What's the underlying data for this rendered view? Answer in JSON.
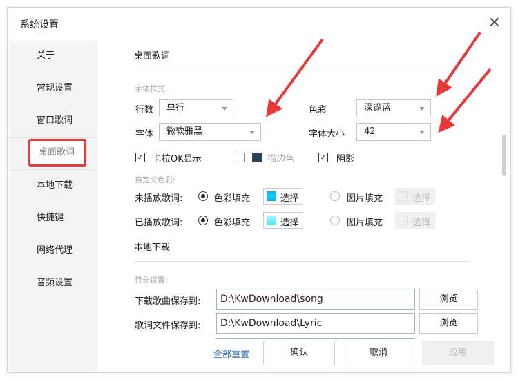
{
  "window": {
    "title": "系统设置"
  },
  "sidebar": {
    "items": [
      {
        "label": "关于"
      },
      {
        "label": "常规设置"
      },
      {
        "label": "窗口歌词"
      },
      {
        "label": "桌面歌词"
      },
      {
        "label": "本地下载"
      },
      {
        "label": "快捷键"
      },
      {
        "label": "网络代理"
      },
      {
        "label": "音频设置"
      }
    ],
    "selected": "桌面歌词"
  },
  "desktop_lyrics": {
    "heading": "桌面歌词",
    "font_style_label": "字体样式:",
    "lines_label": "行数",
    "lines_value": "单行",
    "color_label": "色彩",
    "color_value": "深邃蓝",
    "font_label": "字体",
    "font_value": "微软雅黑",
    "size_label": "字体大小",
    "size_value": "42",
    "karaoke_label": "卡拉OK显示",
    "karaoke_checked": true,
    "stroke_label": "描边色",
    "stroke_checked": false,
    "stroke_color": "#2b3f5a",
    "shadow_label": "阴影",
    "shadow_checked": true,
    "custom_color_label": "自定义色彩:",
    "unplayed_label": "未播放歌词:",
    "played_label": "已播放歌词:",
    "color_fill": "色彩填充",
    "image_fill": "图片填充",
    "choose": "选择"
  },
  "local_download": {
    "heading": "本地下载",
    "dir_label": "目录设置:",
    "song_label": "下载歌曲保存到:",
    "song_path": "D:\\KwDownload\\song",
    "lyric_label": "歌词文件保存到:",
    "lyric_path": "D:\\KwDownload\\Lyric",
    "browse": "浏览"
  },
  "footer": {
    "reset": "全部重置",
    "ok": "确认",
    "cancel": "取消",
    "apply": "应用"
  },
  "colors": {
    "accent": "#e8393a",
    "link": "#2f6fb5"
  }
}
